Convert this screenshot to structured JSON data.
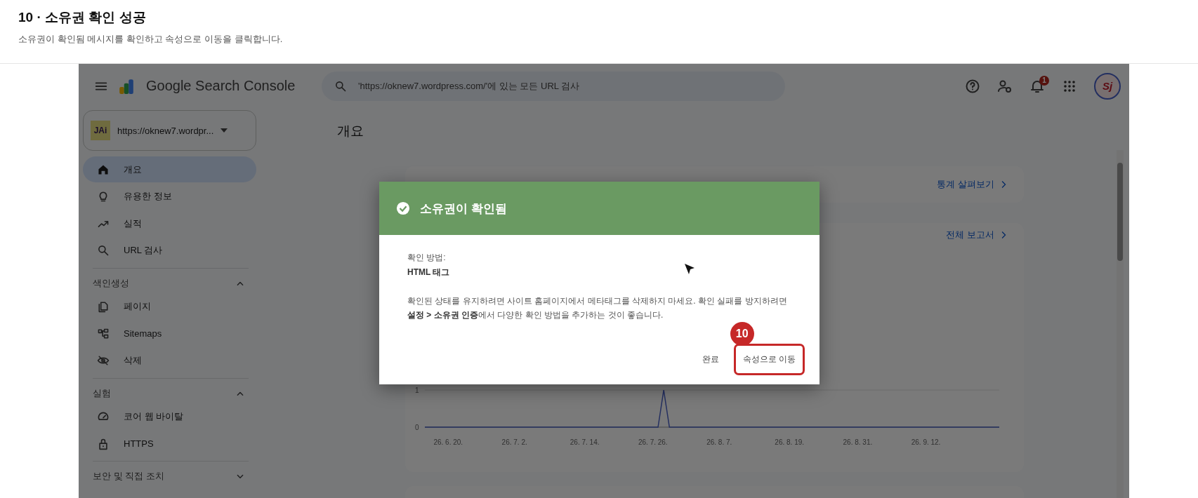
{
  "step": {
    "title": "10 · 소유권 확인 성공",
    "description": "소유권이 확인됨 메시지를 확인하고 속성으로 이동을 클릭합니다."
  },
  "app": {
    "product_name": "Google Search Console",
    "search": {
      "placeholder": "'https://oknew7.wordpress.com/'에 있는 모든 URL 검사"
    },
    "notification_count": "1",
    "avatar_initials": "Sj"
  },
  "property_selector": {
    "logo_text": "JAi",
    "value": "https://oknew7.wordpr..."
  },
  "sidebar": {
    "sections": [
      {
        "items": [
          {
            "label": "개요",
            "selected": true
          },
          {
            "label": "유용한 정보",
            "selected": false
          },
          {
            "label": "실적",
            "selected": false
          },
          {
            "label": "URL 검사",
            "selected": false
          }
        ]
      },
      {
        "heading": "색인생성",
        "expanded": true,
        "items": [
          {
            "label": "페이지",
            "selected": false
          },
          {
            "label": "Sitemaps",
            "selected": false
          },
          {
            "label": "삭제",
            "selected": false
          }
        ]
      },
      {
        "heading": "실험",
        "expanded": true,
        "items": [
          {
            "label": "코어 웹 바이탈",
            "selected": false
          },
          {
            "label": "HTTPS",
            "selected": false
          }
        ]
      },
      {
        "heading": "보안 및 직접 조치",
        "expanded": false
      }
    ]
  },
  "page_title": "개요",
  "cards": [
    {
      "link": "통계 살펴보기"
    },
    {
      "link": "전체 보고서",
      "y_axis_labels": [
        "1",
        "0"
      ],
      "x_axis_labels": [
        "26. 6. 20.",
        "26. 7. 2.",
        "26. 7. 14.",
        "26. 7. 26.",
        "26. 8. 7.",
        "26. 8. 19.",
        "26. 8. 31.",
        "26. 9. 12."
      ]
    }
  ],
  "dialog": {
    "title": "소유권이 확인됨",
    "method_label": "확인 방법:",
    "method_value": "HTML 태그",
    "message": "확인된 상태를 유지하려면 사이트 홈페이지에서 메타태그를 삭제하지 마세요. 확인 실패를 방지하려면 **설정 > 소유권 인증**에서 다양한 확인 방법을 추가하는 것이 좋습니다.",
    "callout_number": "10",
    "buttons": [
      {
        "label": "완료",
        "highlighted": false
      },
      {
        "label": "속성으로 이동",
        "highlighted": true
      }
    ]
  }
}
